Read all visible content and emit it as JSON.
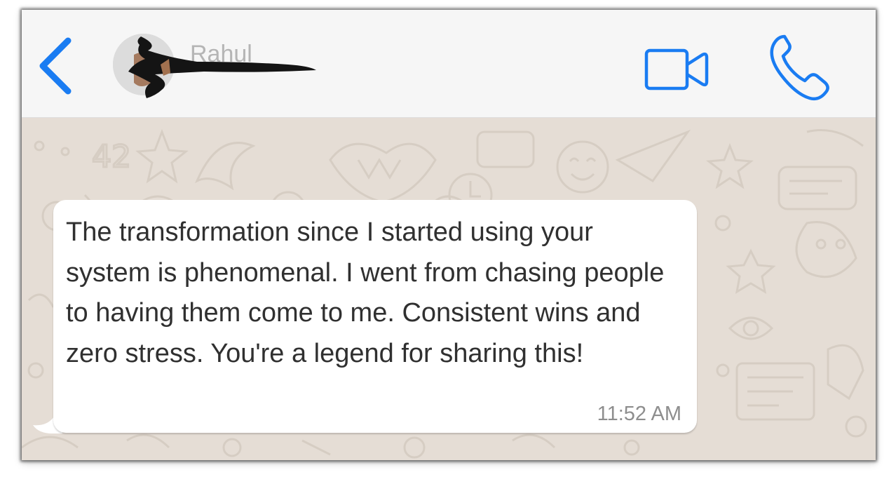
{
  "header": {
    "back_icon": "chevron-left-icon",
    "contact_name": "Rahul",
    "video_icon": "video-camera-icon",
    "call_icon": "phone-icon",
    "accent_color": "#1a7cf2"
  },
  "message": {
    "text": "The transformation since I started using your system is phenomenal. I went from chasing people to having them come to me. Consistent wins and zero stress. You're a legend for sharing this!",
    "time": "11:52 AM"
  }
}
